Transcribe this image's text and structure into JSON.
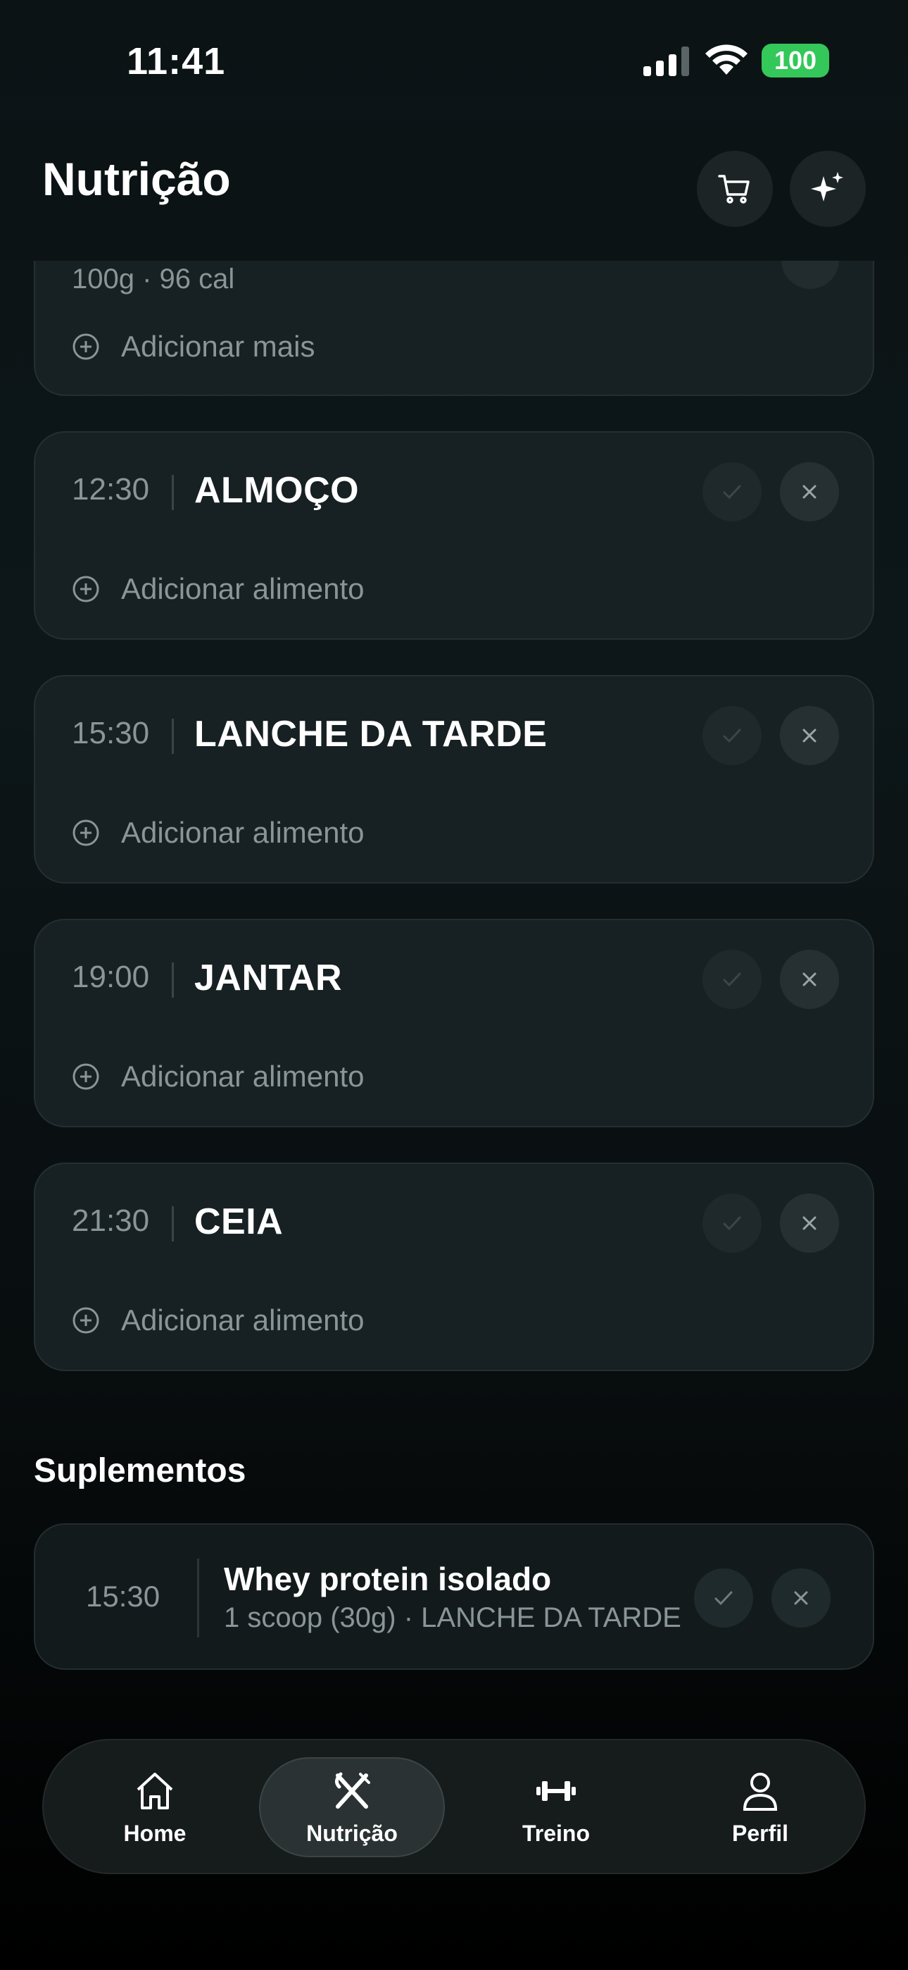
{
  "status_bar": {
    "time": "11:41",
    "battery": "100"
  },
  "header": {
    "title": "Nutrição",
    "cart_icon": "cart-icon",
    "ai_icon": "sparkles-icon"
  },
  "partial_card": {
    "subtitle": "100g · 96 cal",
    "add_more": "Adicionar mais"
  },
  "meals": [
    {
      "time": "12:30",
      "name": "ALMOÇO",
      "add": "Adicionar alimento"
    },
    {
      "time": "15:30",
      "name": "LANCHE DA TARDE",
      "add": "Adicionar alimento"
    },
    {
      "time": "19:00",
      "name": "JANTAR",
      "add": "Adicionar alimento"
    },
    {
      "time": "21:30",
      "name": "CEIA",
      "add": "Adicionar alimento"
    }
  ],
  "supplements": {
    "title": "Suplementos",
    "items": [
      {
        "time": "15:30",
        "name": "Whey protein isolado",
        "detail": "1 scoop (30g) · LANCHE DA TARDE"
      }
    ]
  },
  "tabbar": {
    "items": [
      {
        "label": "Home",
        "icon": "home-icon"
      },
      {
        "label": "Nutrição",
        "icon": "fork-knife-icon",
        "active": true
      },
      {
        "label": "Treino",
        "icon": "dumbbell-icon"
      },
      {
        "label": "Perfil",
        "icon": "person-icon"
      }
    ]
  },
  "colors": {
    "battery": "#34c759",
    "background": "#0b1315",
    "card": "#172022",
    "muted_text": "#8a9597"
  }
}
